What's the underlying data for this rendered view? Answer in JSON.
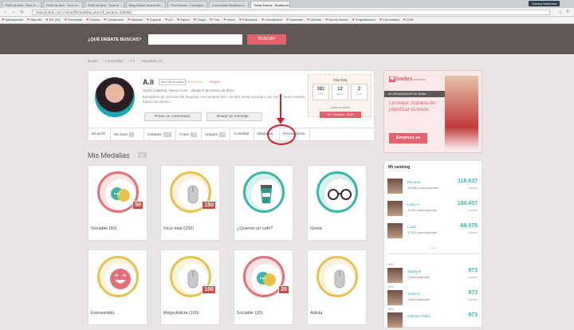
{
  "browser": {
    "tabs": [
      "Perfil de Ana - Todo lo ...",
      "Perfil de Ana - Todo lo ...",
      "Perfil de Ana - Todo lo ...",
      "Blog Bodas Nueva Bo...",
      "Foro Bodas - Consejos ...",
      "Comunidad Bodasmex...",
      "Todas Nueva - Bodasmex..."
    ],
    "window_label": "Monica Natividad",
    "url": "www.bodas.com.mx/perfil/medallas.php?id_usuario=106082",
    "bookmarks": [
      "Aplicaciones",
      "Reporte",
      "BD (34)",
      "Gerencias",
      "Gastos",
      "Camarones",
      "Minutas",
      "Soporte",
      "UX",
      "Sabes",
      "Carga",
      "Foto",
      "Video",
      "Educacion",
      "Coordinador",
      "Gerentes",
      "Deloitte",
      "Nueva Nodes",
      "Programacion",
      "Comunidad",
      "DHA"
    ]
  },
  "header": {
    "search_question": "¿QUÉ DEBATE BUSCAS?",
    "search_placeholder": "",
    "search_button": "BUSCAR"
  },
  "breadcrumb": [
    "Bodas",
    "Comunidad",
    "A.li",
    "Medallas A.li"
  ],
  "profile": {
    "name": "A.li",
    "badge": "Nivel Novia Activa",
    "points": "121 puntos",
    "follow": "Seguir",
    "location": "Santa Catarina, Nuevo León · Desde 9 de Enero de 2013",
    "description": "Estudiante de ciencias del lenguaje, me encanta leer, escribir, llevar la boda y ver con el futuro marido todos mis planes...",
    "btn_comment": "Poner un comentario",
    "btn_message": "Enviar un mensaje",
    "stats_title": "FALTAN",
    "stats": [
      {
        "value": "381",
        "label": "Días"
      },
      {
        "value": "12",
        "label": "Meses"
      },
      {
        "value": "2",
        "label": "Años"
      }
    ],
    "stats_note": "para mi boda",
    "stats_date": "20 · Octubre · 2014",
    "tabs": [
      {
        "label": "Mi perfil",
        "count": ""
      },
      {
        "label": "Mi muro",
        "count": "0"
      },
      {
        "label": "Debates",
        "count": "283"
      },
      {
        "label": "Fotos",
        "count": "31"
      },
      {
        "label": "Amigos",
        "count": "10"
      },
      {
        "label": "Actividad",
        "count": ""
      },
      {
        "label": "Medallas",
        "count": ""
      },
      {
        "label": "Proveedores",
        "count": ""
      }
    ]
  },
  "medals": {
    "title": "Mis Medallas",
    "count": "14",
    "items": [
      {
        "label": "Sociable (50)",
        "num": "50",
        "ring": "#e36f78",
        "icon": "chat-bubbles-icon"
      },
      {
        "label": "Vicio total (150)",
        "num": "150",
        "ring": "#e5c24e",
        "icon": "mouse-icon"
      },
      {
        "label": "¿Quieres un café?",
        "num": "",
        "ring": "#3cb4a6",
        "icon": "coffee-cup-icon"
      },
      {
        "label": "Genia",
        "num": "",
        "ring": "#3cb4a6",
        "icon": "glasses-icon"
      },
      {
        "label": "Extrovertido",
        "num": "",
        "ring": "#e5c24e",
        "icon": "laughing-face-icon"
      },
      {
        "label": "Mega Adicta (100)",
        "num": "100",
        "ring": "#e5c24e",
        "icon": "mouse-icon"
      },
      {
        "label": "Sociable (20)",
        "num": "20",
        "ring": "#e36f78",
        "icon": "chat-bubbles-icon"
      },
      {
        "label": "Adicta",
        "num": "",
        "ring": "#e5c24e",
        "icon": "mouse-icon"
      }
    ]
  },
  "ad": {
    "logo": "bodas",
    "logo_suffix": ".com.mx",
    "bar": "MI ORGANIZADOR DE BODA",
    "title": "La mejor manera de planificar tu boda",
    "button": "Empieza ya"
  },
  "ranking": {
    "title": "Mi ranking",
    "rows": [
      {
        "name": "Pecoma",
        "sub": "115.862 para superarte",
        "pts": "116.637",
        "pl": "puntos",
        "pos": ""
      },
      {
        "name": "Lorie A.",
        "sub": "15.856 para superarte",
        "pts": "100.457",
        "pl": "puntos",
        "pos": ""
      },
      {
        "name": "Lucia",
        "sub": "37.404 para superarte",
        "pts": "68.375",
        "pl": "puntos",
        "pos": ""
      },
      {
        "name": "Sandy R.",
        "sub": "1 para superarte",
        "pts": "973",
        "pl": "puntos",
        "pos": "1922"
      },
      {
        "name": "Jessica",
        "sub": "1 para superarte",
        "pts": "973",
        "pl": "puntos",
        "pos": "1923"
      },
      {
        "name": "Carmen Oviña",
        "sub": "",
        "pts": "973",
        "pl": "",
        "pos": "1924"
      }
    ]
  },
  "colors": {
    "accent": "#e8606b",
    "header_bg": "#5f5656",
    "teal": "#3cb4a6",
    "annotation_red": "#d01f2e"
  }
}
